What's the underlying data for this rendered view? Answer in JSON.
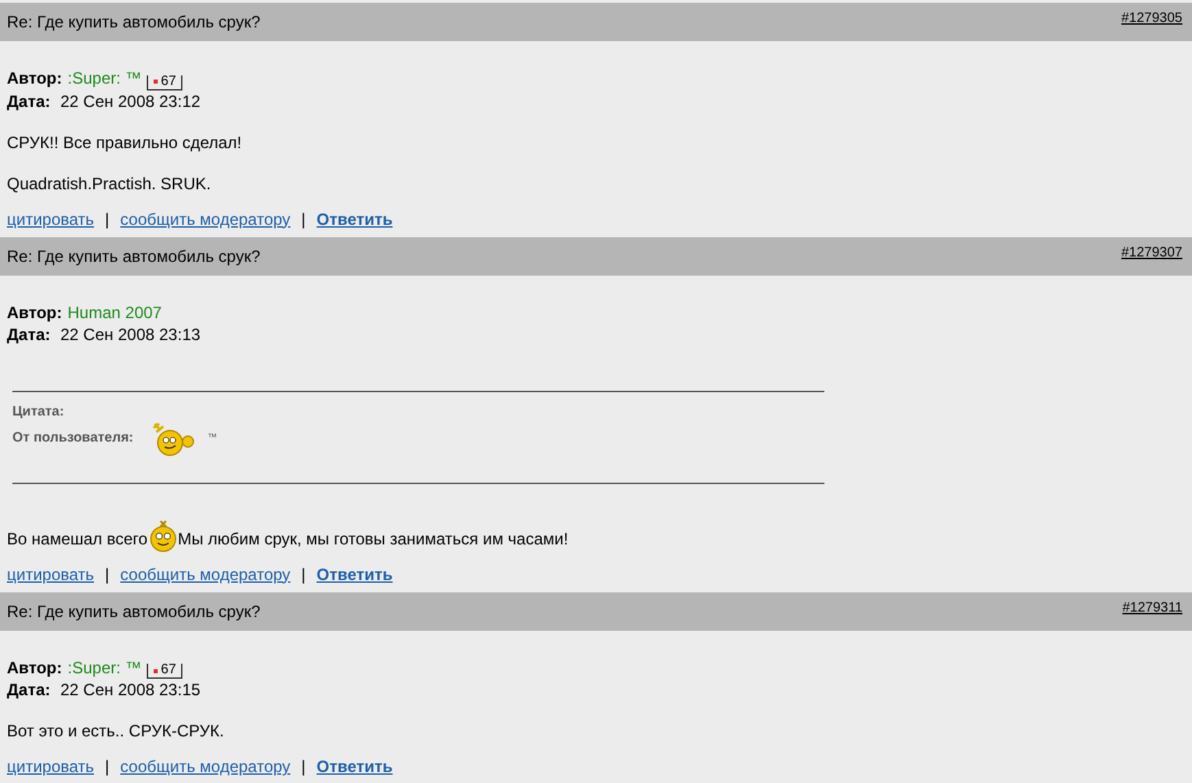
{
  "posts": [
    {
      "title": "Re: Где купить автомобиль срук?",
      "number": "#1279305",
      "author_label": "Автор:",
      "author": ":Super: ™",
      "rating": "67",
      "date_label": "Дата:",
      "date": "22 Сен 2008 23:12",
      "body": [
        {
          "kind": "text",
          "text": "СРУК!! Все правильно сделал!"
        },
        {
          "kind": "text",
          "text": "Quadratish.Practish. SRUK."
        }
      ],
      "actions": [
        {
          "kind": "link",
          "label": "цитировать"
        },
        {
          "kind": "separator",
          "label": "|"
        },
        {
          "kind": "link",
          "label": "сообщить модератору"
        },
        {
          "kind": "separator",
          "label": "|"
        },
        {
          "kind": "strong",
          "label": "Ответить"
        }
      ]
    },
    {
      "title": "Re: Где купить автомобиль срук?",
      "number": "#1279307",
      "author_label": "Автор:",
      "author": "Human 2007",
      "date_label": "Дата:",
      "date": "22 Сен 2008 23:13",
      "body": [
        {
          "kind": "quote",
          "label": "Цитата:",
          "from_label": "От пользователя:",
          "trademark": "™"
        },
        {
          "kind": "smiley_text",
          "before": "Во намешал всего",
          "after": "Мы любим срук, мы готовы заниматься им часами!"
        }
      ],
      "actions": [
        {
          "kind": "link",
          "label": "цитировать"
        },
        {
          "kind": "separator",
          "label": "|"
        },
        {
          "kind": "link",
          "label": "сообщить модератору"
        },
        {
          "kind": "separator",
          "label": "|"
        },
        {
          "kind": "strong",
          "label": "Ответить"
        }
      ]
    },
    {
      "title": "Re: Где купить автомобиль срук?",
      "number": "#1279311",
      "author_label": "Автор:",
      "author": ":Super: ™",
      "rating": "67",
      "date_label": "Дата:",
      "date": "22 Сен 2008 23:15",
      "body": [
        {
          "kind": "text",
          "text": "Вот это и есть.. СРУК-СРУК."
        }
      ],
      "actions": [
        {
          "kind": "link",
          "label": "цитировать"
        },
        {
          "kind": "separator",
          "label": "|"
        },
        {
          "kind": "link",
          "label": "сообщить модератору"
        },
        {
          "kind": "separator",
          "label": "|"
        },
        {
          "kind": "strong",
          "label": "Ответить"
        }
      ]
    }
  ]
}
